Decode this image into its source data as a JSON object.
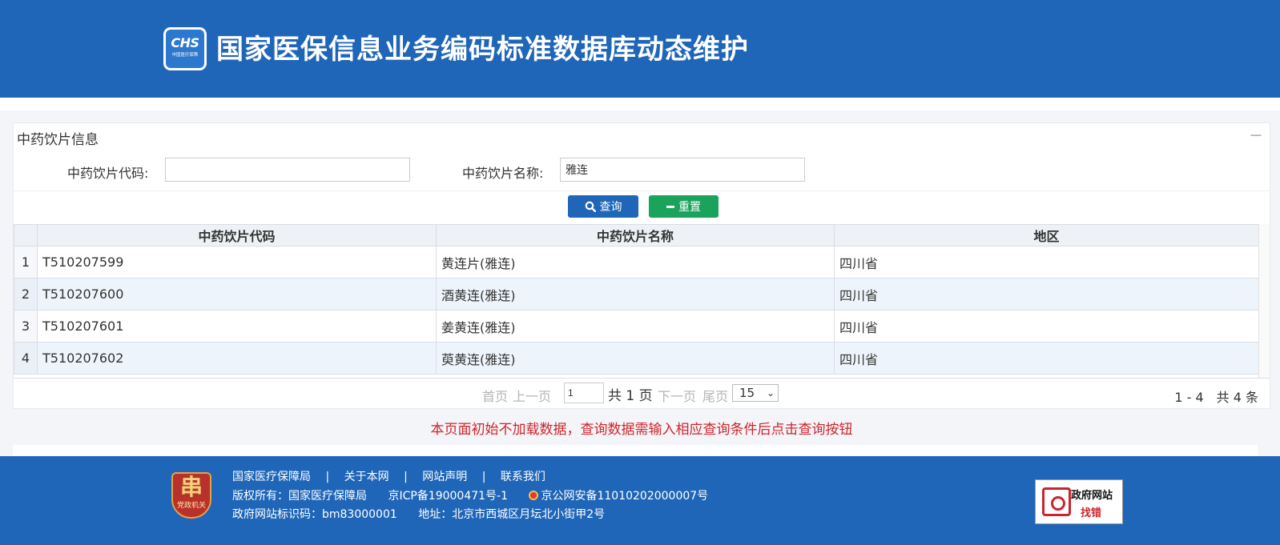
{
  "header": {
    "logo_text": "CHS",
    "logo_subtext": "中国医疗保障",
    "title": "国家医保信息业务编码标准数据库动态维护"
  },
  "panel": {
    "title": "中药饮片信息",
    "collapse_symbol": "－"
  },
  "search": {
    "code_label": "中药饮片代码:",
    "code_value": "",
    "name_label": "中药饮片名称:",
    "name_value": "雅连",
    "query_label": "查询",
    "reset_label": "重置"
  },
  "table": {
    "columns": [
      "中药饮片代码",
      "中药饮片名称",
      "地区"
    ],
    "rows": [
      {
        "index": "1",
        "code": "T510207599",
        "name": "黄连片(雅连)",
        "region": "四川省"
      },
      {
        "index": "2",
        "code": "T510207600",
        "name": "酒黄连(雅连)",
        "region": "四川省"
      },
      {
        "index": "3",
        "code": "T510207601",
        "name": "姜黄连(雅连)",
        "region": "四川省"
      },
      {
        "index": "4",
        "code": "T510207602",
        "name": "萸黄连(雅连)",
        "region": "四川省"
      }
    ]
  },
  "pager": {
    "first": "首页",
    "prev": "上一页",
    "page_value": "1",
    "total_pages": "共 1 页",
    "next": "下一页",
    "last": "尾页",
    "page_size": "15",
    "summary": "1 - 4　共 4 条"
  },
  "notice": "本页面初始不加载数据，查询数据需输入相应查询条件后点击查询按钮",
  "footer": {
    "links": [
      "国家医疗保障局",
      "关于本网",
      "网站声明",
      "联系我们"
    ],
    "separator": "|",
    "copyright": "版权所有：国家医疗保障局",
    "icp": "京ICP备19000471号-1",
    "police": "京公网安备11010202000007号",
    "site_id": "政府网站标识码：bm83000001",
    "address": "地址：北京市西城区月坛北小街甲2号",
    "badge_text": "党政机关",
    "gov_box_title": "政府网站",
    "gov_box_action": "找错"
  },
  "colors": {
    "header_blue": "#1f66b8",
    "query_button": "#1f66b8",
    "reset_button": "#1aa35b",
    "notice_red": "#d1242a"
  }
}
